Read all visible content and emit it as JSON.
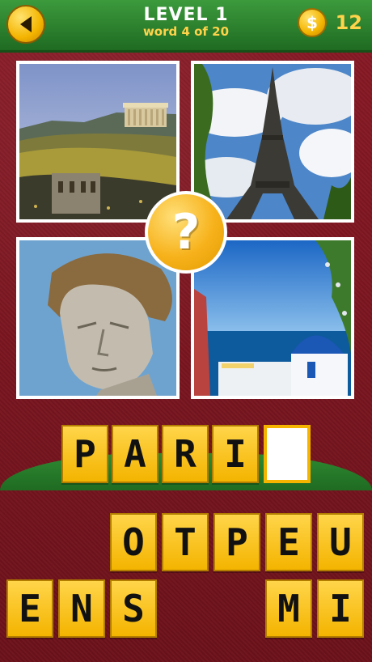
{
  "header": {
    "level": "LEVEL 1",
    "word_progress": "word 4 of 20",
    "coins": "12",
    "coin_symbol": "$"
  },
  "photos": [
    {
      "subject": "acropolis"
    },
    {
      "subject": "eiffel-tower"
    },
    {
      "subject": "statue-head"
    },
    {
      "subject": "santorini"
    }
  ],
  "hint_symbol": "?",
  "answer": {
    "letters": [
      "P",
      "A",
      "R",
      "I",
      ""
    ]
  },
  "letter_pool": {
    "row1": [
      "",
      "",
      "O",
      "T",
      "P",
      "E",
      "U"
    ],
    "row2": [
      "E",
      "N",
      "S",
      "",
      "",
      "M",
      "I"
    ]
  },
  "colors": {
    "tile": "#f4b400",
    "header_green": "#2e8a32",
    "background": "#7a1621"
  }
}
